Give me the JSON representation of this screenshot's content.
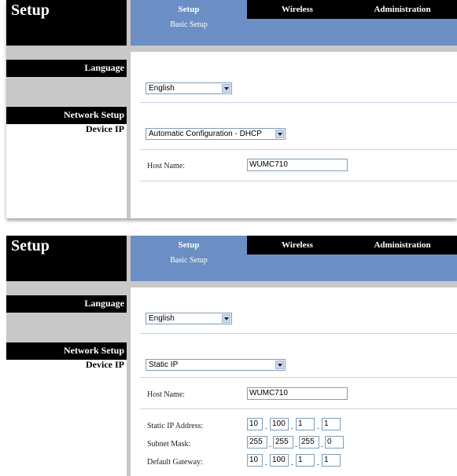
{
  "nav": {
    "section": "Setup",
    "tabs": [
      "Setup",
      "Wireless",
      "Administration"
    ],
    "subtab": "Basic Setup"
  },
  "sidebar": {
    "language": "Language",
    "network_setup": "Network Setup",
    "device_ip": "Device IP"
  },
  "panel1": {
    "language_value": "English",
    "ip_mode": "Automatic Configuration - DHCP",
    "host_name_label": "Host Name:",
    "host_name_value": "WUMC710"
  },
  "panel2": {
    "language_value": "English",
    "ip_mode": "Static IP",
    "host_name_label": "Host Name:",
    "host_name_value": "WUMC710",
    "static_ip_label": "Static IP Address:",
    "static_ip": [
      "10",
      "100",
      "1",
      "1"
    ],
    "subnet_label": "Subnet Mask:",
    "subnet": [
      "255",
      "255",
      "255",
      "0"
    ],
    "gateway_label": "Default Gateway:",
    "gateway": [
      "10",
      "100",
      "1",
      "1"
    ]
  }
}
